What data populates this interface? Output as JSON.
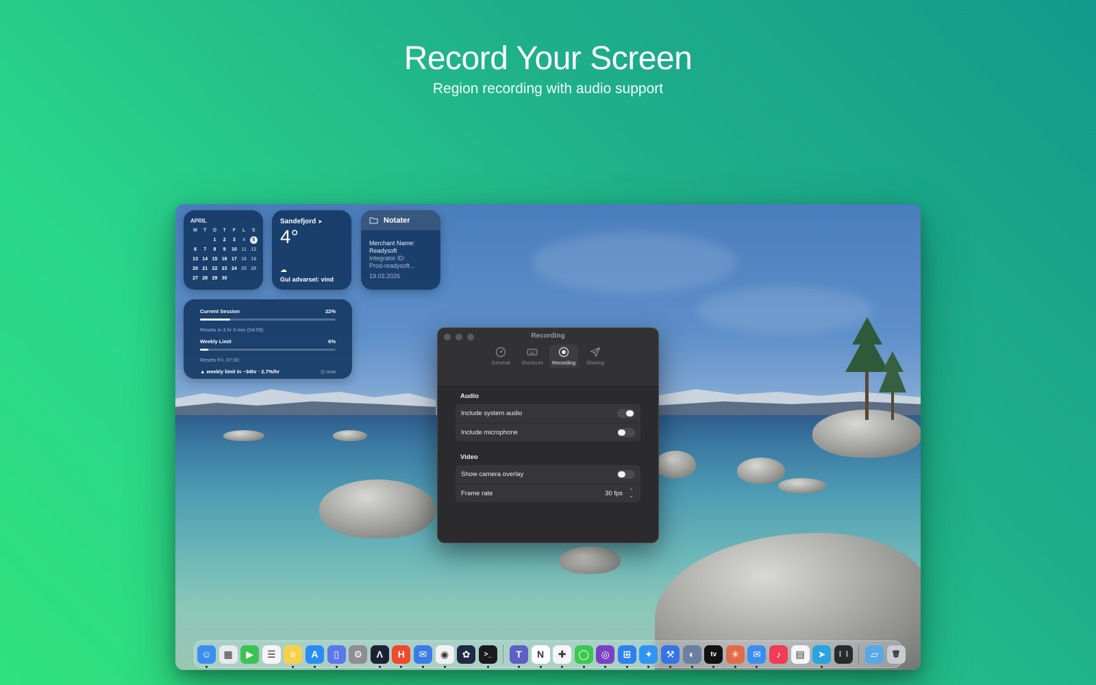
{
  "hero": {
    "title": "Record Your Screen",
    "subtitle": "Region recording with audio support"
  },
  "calendar": {
    "month": "APRIL",
    "weekdays": [
      "M",
      "T",
      "O",
      "T",
      "F",
      "L",
      "S"
    ],
    "today": "5",
    "weeks": [
      [
        "",
        "",
        "1",
        "2",
        "3",
        "4",
        "5"
      ],
      [
        "6",
        "7",
        "8",
        "9",
        "10",
        "11",
        "12"
      ],
      [
        "13",
        "14",
        "15",
        "16",
        "17",
        "18",
        "19"
      ],
      [
        "20",
        "21",
        "22",
        "23",
        "24",
        "25",
        "26"
      ],
      [
        "27",
        "28",
        "29",
        "30",
        "",
        "",
        ""
      ]
    ]
  },
  "weather": {
    "city": "Sandefjord",
    "location_icon": "location-arrow-icon",
    "temperature": "4°",
    "condition_icon": "cloud-icon",
    "alert": "Gul advarsel: vind"
  },
  "notes": {
    "title": "Notater",
    "icon": "folder-icon",
    "line1": "Merchant Name:",
    "line2": "Readysoft",
    "line3": "Integrator ID:",
    "line4": "Prod-readysoft...",
    "date": "19.03.2026"
  },
  "usage": {
    "session_label": "Current Session",
    "session_percent": "22%",
    "session_fraction": 0.22,
    "session_reset": "Resets in 3 hr 0 min (04:59)",
    "weekly_label": "Weekly Limit",
    "weekly_percent": "6%",
    "weekly_fraction": 0.06,
    "weekly_reset": "Resets Fri, 07:00",
    "warning": "weekly limit in ~34hr · 2.7%/hr",
    "updated": "now"
  },
  "window": {
    "title": "Recording",
    "tabs": [
      {
        "label": "General",
        "icon": "gauge-icon",
        "active": false
      },
      {
        "label": "Shortcuts",
        "icon": "keyboard-icon",
        "active": false
      },
      {
        "label": "Recording",
        "icon": "record-icon",
        "active": true
      },
      {
        "label": "Sharing",
        "icon": "paper-plane-icon",
        "active": false
      }
    ],
    "audio": {
      "heading": "Audio",
      "system_audio_label": "Include system audio",
      "system_audio_on": true,
      "microphone_label": "Include microphone",
      "microphone_on": false
    },
    "video": {
      "heading": "Video",
      "camera_label": "Show camera overlay",
      "camera_on": false,
      "frame_rate_label": "Frame rate",
      "frame_rate_value": "30 fps"
    }
  },
  "dock": {
    "apps": [
      {
        "name": "finder-icon",
        "color": "#3a8ef0",
        "glyph": "☺",
        "running": true
      },
      {
        "name": "launchpad-icon",
        "color": "#e9e9ee",
        "glyph": "▦",
        "running": false
      },
      {
        "name": "facetime-icon",
        "color": "#3cc251",
        "glyph": "▶",
        "running": false
      },
      {
        "name": "reminders-icon",
        "color": "#f5f5f7",
        "glyph": "☰",
        "running": false
      },
      {
        "name": "notes-icon",
        "color": "#f7d04b",
        "glyph": "≡",
        "running": true
      },
      {
        "name": "app-store-icon",
        "color": "#2a8df2",
        "glyph": "A",
        "running": true
      },
      {
        "name": "simulator-icon",
        "color": "#5a78e8",
        "glyph": "▯",
        "running": true
      },
      {
        "name": "system-settings-icon",
        "color": "#8e8e93",
        "glyph": "⚙",
        "running": false
      },
      {
        "name": "arc-icon",
        "color": "#1c2233",
        "glyph": "Λ",
        "running": true
      },
      {
        "name": "harvest-icon",
        "color": "#f04a2a",
        "glyph": "H",
        "running": true
      },
      {
        "name": "mail-client-icon",
        "color": "#3b7de8",
        "glyph": "✉",
        "running": true
      },
      {
        "name": "chrome-icon",
        "color": "#f2f2f2",
        "glyph": "◉",
        "running": true
      },
      {
        "name": "chatgpt-icon",
        "color": "#1e2a44",
        "glyph": "✿",
        "running": false
      },
      {
        "name": "terminal-icon",
        "color": "#1b1b1d",
        "glyph": ">_",
        "running": true
      },
      {
        "name": "sep",
        "color": "",
        "glyph": "",
        "running": false
      },
      {
        "name": "teams-icon",
        "color": "#5b5fc7",
        "glyph": "T",
        "running": true
      },
      {
        "name": "notion-icon",
        "color": "#fdfdfd",
        "glyph": "N",
        "running": true
      },
      {
        "name": "slack-icon",
        "color": "#f5f5f5",
        "glyph": "✚",
        "running": true
      },
      {
        "name": "messages-icon",
        "color": "#3bc84f",
        "glyph": "◯",
        "running": true
      },
      {
        "name": "github-icon",
        "color": "#7a3fc2",
        "glyph": "◎",
        "running": true
      },
      {
        "name": "windows-app-icon",
        "color": "#2f7ff0",
        "glyph": "⊞",
        "running": true
      },
      {
        "name": "safari-icon",
        "color": "#2f95f5",
        "glyph": "✦",
        "running": true
      },
      {
        "name": "xcode-icon",
        "color": "#3474e6",
        "glyph": "⚒",
        "running": true
      },
      {
        "name": "proxyman-icon",
        "color": "#6c7fa0",
        "glyph": "◐",
        "running": true
      },
      {
        "name": "apple-tv-icon",
        "color": "#111111",
        "glyph": "tv",
        "running": true
      },
      {
        "name": "claude-icon",
        "color": "#e26b4a",
        "glyph": "✳",
        "running": true
      },
      {
        "name": "mail-icon",
        "color": "#3a8ef0",
        "glyph": "✉",
        "running": true
      },
      {
        "name": "music-icon",
        "color": "#f23b54",
        "glyph": "♪",
        "running": false
      },
      {
        "name": "textedit-icon",
        "color": "#f5f5f7",
        "glyph": "▤",
        "running": false
      },
      {
        "name": "telegram-icon",
        "color": "#2aa3e0",
        "glyph": "➤",
        "running": true
      },
      {
        "name": "more-apps-icon",
        "color": "#2a2a2c",
        "glyph": "⋮⋮",
        "running": false
      },
      {
        "name": "sep",
        "color": "",
        "glyph": "",
        "running": false
      },
      {
        "name": "downloads-folder-icon",
        "color": "#5aa9e6",
        "glyph": "▱",
        "running": false
      },
      {
        "name": "trash-icon",
        "color": "#c9ccd1",
        "glyph": "🗑",
        "running": false
      }
    ]
  }
}
